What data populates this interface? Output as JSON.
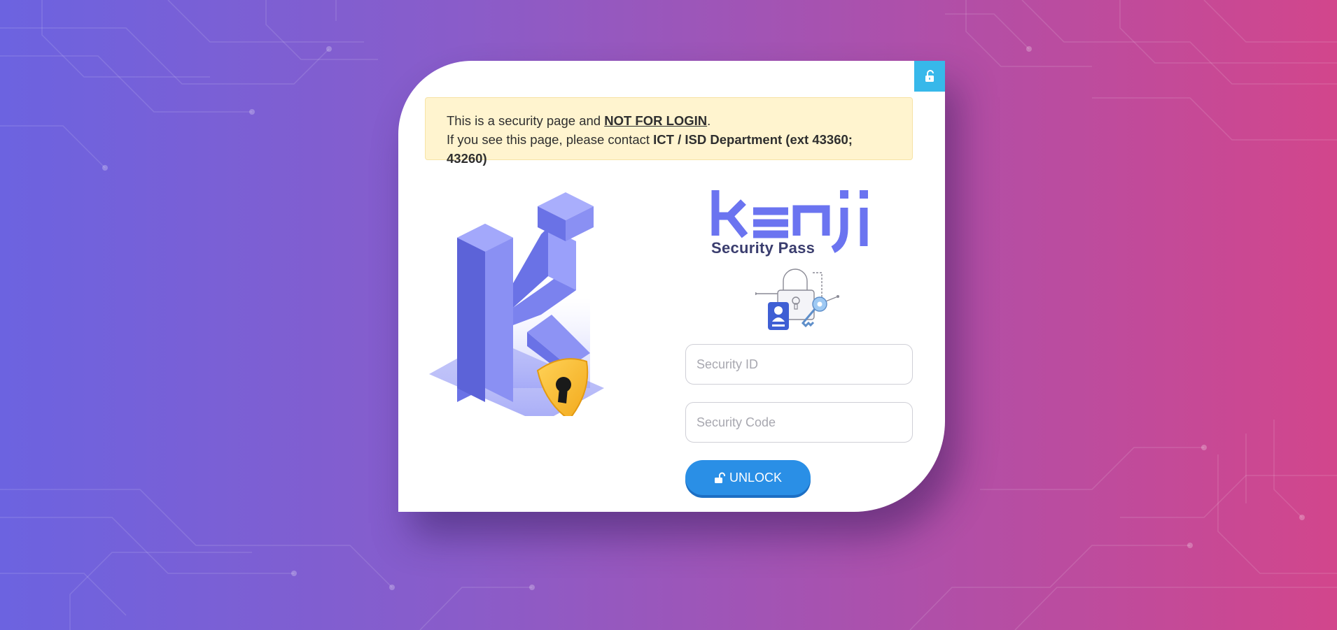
{
  "alert": {
    "line1_prefix": "This is a security page and ",
    "line1_emphasis": "NOT FOR LOGIN",
    "line1_suffix": ".",
    "line2_prefix": "If you see this page, please contact ",
    "line2_emphasis": "ICT / ISD Department (ext 43360; 43260)"
  },
  "brand": {
    "name": "kenji",
    "subtitle": "Security Pass",
    "color": "#6b74f0"
  },
  "form": {
    "security_id_placeholder": "Security ID",
    "security_code_placeholder": "Security Code",
    "unlock_label": "UNLOCK"
  },
  "colors": {
    "accent_tab": "#37b8ea",
    "button": "#2a8fe6",
    "alert_bg": "#fff4cf"
  },
  "icons": {
    "corner": "unlock-icon",
    "button": "unlock-icon",
    "illustration": "k-logo-shield-illustration",
    "security": "padlock-key-id-icon"
  }
}
